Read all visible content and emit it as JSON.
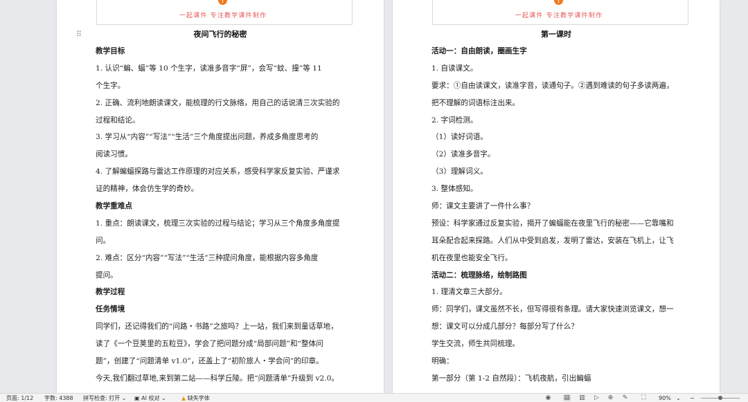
{
  "header": {
    "brand_text": "一起课件  专注教学课件制作"
  },
  "left_page": {
    "title": "夜间飞行的秘密",
    "lines": [
      {
        "text": "教学目标",
        "bold": true
      },
      {
        "text": "1. 认识“蝙、蝠”等 10 个生字，读准多音字“屏”，会写“蚊、撞”等 11",
        "bold": false
      },
      {
        "text": "个生字。",
        "bold": false
      },
      {
        "text": "2. 正确、流利地朗读课文，能梳理的行文脉络，用自己的话说清三次实验的",
        "bold": false
      },
      {
        "text": "过程和结论。",
        "bold": false
      },
      {
        "text": "3. 学习从“内容”“写法”“生活”三个角度提出问题，养成多角度思考的",
        "bold": false
      },
      {
        "text": "阅读习惯。",
        "bold": false
      },
      {
        "text": "4. 了解蝙蝠探路与雷达工作原理的对应关系，感受科学家反复实验、严谨求",
        "bold": false
      },
      {
        "text": "证的精神，体会仿生学的奇妙。",
        "bold": false
      },
      {
        "text": "教学重难点",
        "bold": true
      },
      {
        "text": "1. 重点：朗读课文，梳理三次实验的过程与结论；学习从三个角度多角度提",
        "bold": false
      },
      {
        "text": "问。",
        "bold": false
      },
      {
        "text": "2. 难点：区分“内容”“写法”“生活”三种提问角度，能根据内容多角度",
        "bold": false
      },
      {
        "text": "提问。",
        "bold": false
      },
      {
        "text": "教学过程",
        "bold": true
      },
      {
        "text": "任务情境",
        "bold": true
      },
      {
        "text": "同学们，还记得我们的“问路・书路”之旅吗？上一站，我们来到童话草地，",
        "bold": false
      },
      {
        "text": "读了《一个豆荚里的五粒豆》，学会了把问题分成“局部问题”和“整体问",
        "bold": false
      },
      {
        "text": "题”，创建了“问题清单 v1.0”，还盖上了“初阶旅人・学会问”的印章。",
        "bold": false
      },
      {
        "text": "今天,我们翻过草地,来到第二站——科学丘陵。把“问题清单”升级到 v2.0。",
        "bold": false
      }
    ]
  },
  "right_page": {
    "title": "第一课时",
    "lines": [
      {
        "text": "活动一：自由朗读，圈画生字",
        "bold": true
      },
      {
        "text": "1. 自读课文。",
        "bold": false
      },
      {
        "text": "要求：①自由读课文，读准字音，读通句子。②遇到难读的句子多读两遍，",
        "bold": false
      },
      {
        "text": "把不理解的词语标注出来。",
        "bold": false
      },
      {
        "text": "2. 字词检测。",
        "bold": false
      },
      {
        "text": "（1）读好词语。",
        "bold": false
      },
      {
        "text": "（2）读准多音字。",
        "bold": false
      },
      {
        "text": "（3）理解词义。",
        "bold": false
      },
      {
        "text": "3. 整体感知。",
        "bold": false
      },
      {
        "text": "师：课文主要讲了一件什么事？",
        "bold": false
      },
      {
        "text": "预设：科学家通过反复实验，揭开了蝙蝠能在夜里飞行的秘密——它靠嘴和",
        "bold": false
      },
      {
        "text": "耳朵配合起来探路。人们从中受到启发，发明了雷达，安装在飞机上，让飞",
        "bold": false
      },
      {
        "text": "机在夜里也能安全飞行。",
        "bold": false
      },
      {
        "text": "活动二：梳理脉络，绘制路图",
        "bold": true
      },
      {
        "text": "1. 理清文章三大部分。",
        "bold": false
      },
      {
        "text": "师：同学们，课文虽然不长，但写得很有条理。请大家快速浏览课文，想一",
        "bold": false
      },
      {
        "text": "想：课文可以分成几部分？每部分写了什么？",
        "bold": false
      },
      {
        "text": "学生交流，师生共同梳理。",
        "bold": false
      },
      {
        "text": "明确：",
        "bold": false
      },
      {
        "text": "第一部分（第 1-2 自然段）：飞机夜航，引出蝙蝠",
        "bold": false
      }
    ]
  },
  "statusbar": {
    "page_info": "页面: 1/12",
    "word_count": "字数: 4388",
    "spell_check": "拼写检查: 打开",
    "ai_proof": "AI 校对",
    "missing_font": "缺失字体",
    "zoom": "90%",
    "zoom_level_percent": 90
  }
}
